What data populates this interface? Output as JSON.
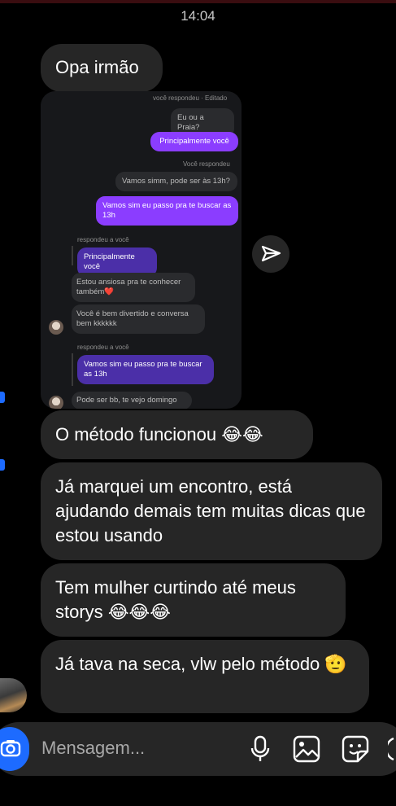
{
  "status": {
    "time": "14:04"
  },
  "messages": {
    "m1": "Opa irmão",
    "m2_text": "O método funcionou",
    "m2_emoji": "😂😂",
    "m3": "Já marquei um encontro, está ajudando demais tem muitas dicas que estou usando",
    "m4_text": "Tem mulher curtindo até meus storys",
    "m4_emoji": "😂😂😂",
    "m5_text": "Já tava na seca, vlw pelo método",
    "m5_emoji": "🫡"
  },
  "shared_screenshot": {
    "top_meta": "você respondeu · Editado",
    "q1": "Eu ou a Praia?",
    "a1": "Principalmente você",
    "meta2": "Você respondeu",
    "q2": "Vamos simm, pode ser às 13h?",
    "a2": "Vamos sim eu passo pra te buscar as 13h",
    "meta3": "respondeu a você",
    "quote1": "Principalmente você",
    "r1": "Estou ansiosa pra te conhecer também❤️",
    "r2": "Você é bem divertido e conversa bem kkkkkk",
    "meta4": "respondeu a você",
    "quote2": "Vamos sim eu passo pra te buscar as 13h",
    "r3": "Pode ser bb, te vejo domingo"
  },
  "composer": {
    "placeholder": "Mensagem..."
  },
  "icons": [
    "camera-icon",
    "microphone-icon",
    "gallery-icon",
    "sticker-icon",
    "plus-icon",
    "send-icon"
  ],
  "colors": {
    "bubble": "#262626",
    "accent": "#1d6bff",
    "purple": "#8b3dff"
  }
}
